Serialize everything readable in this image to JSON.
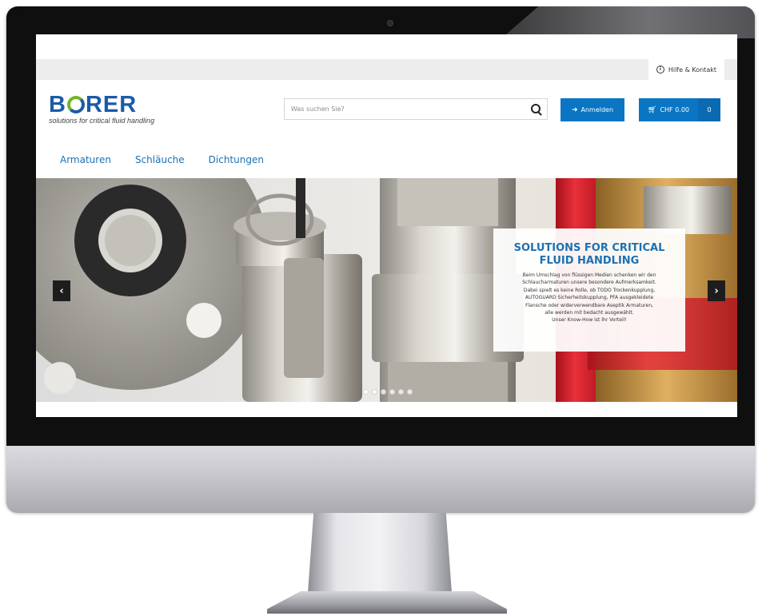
{
  "header": {
    "help_label": "Hilfe & Kontakt",
    "logo_word_pre": "B",
    "logo_word_post": "RER",
    "logo_tagline": "solutions for critical fluid handling",
    "search_placeholder": "Was suchen Sie?",
    "login_label": "Anmelden",
    "cart_label": "CHF 0.00",
    "cart_count": "0"
  },
  "nav": {
    "items": [
      {
        "label": "Armaturen"
      },
      {
        "label": "Schläuche"
      },
      {
        "label": "Dichtungen"
      }
    ]
  },
  "hero": {
    "title": "SOLUTIONS FOR CRITICAL FLUID HANDLING",
    "text_lines": [
      "Beim Umschlag von flüssigen Medien schenken wir den",
      "Schlaucharmaturen unsere besondere Aufmerksamkeit.",
      "Dabei spielt es keine Rolle, ob TODO Trockenkupplung,",
      "AUTOGUARD Sicherheitskupplung, PFA ausgekleidete",
      "Flansche oder widerverwendbare Aseptik Armaturen,",
      "alle werden mit bedacht ausgewählt.",
      "Unser Know-How ist Ihr Vorteil!"
    ],
    "dot_count": 6,
    "active_dot": 1
  },
  "colors": {
    "accent": "#0a75c2",
    "nav_text": "#1c71b3",
    "logo_blue": "#1b5aa8",
    "logo_green": "#6fb52c"
  },
  "icons": {
    "help": "info-circle-icon",
    "search": "search-icon",
    "login": "sign-in-icon",
    "cart": "shopping-cart-icon",
    "prev": "chevron-left-icon",
    "next": "chevron-right-icon"
  }
}
